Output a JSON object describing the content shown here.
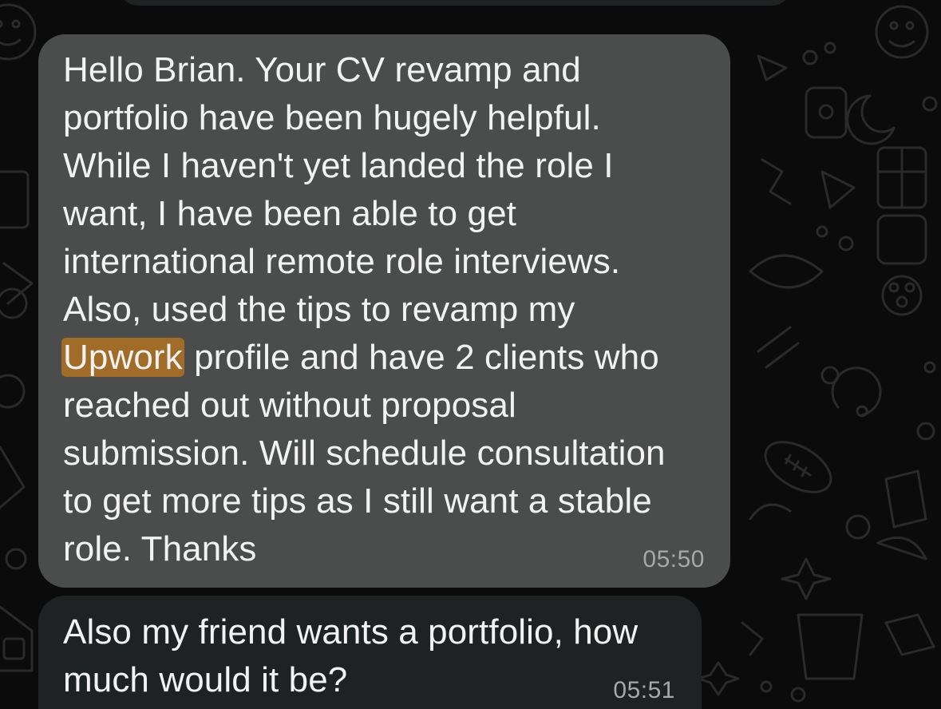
{
  "conversation": {
    "wallpaper": "doodle-pattern-dark",
    "colors": {
      "incoming_bubble": "#4b4c4c",
      "incoming_bubble_dark": "#1f2223",
      "search_highlight": "#a06c28",
      "text": "#f2f2f2",
      "timestamp": "#a7a8a8"
    },
    "messages": [
      {
        "lines": [
          "Hello Brian. Your CV revamp and",
          "portfolio have been hugely helpful.",
          "While I haven't yet landed the role I",
          "want, I have been able to get",
          "international remote role interviews.",
          "Also, used the tips to revamp my"
        ],
        "highlight_word": "Upwork",
        "highlight_line_rest": " profile and have 2 clients who",
        "lines_after": [
          "reached out without proposal",
          "submission. Will schedule consultation",
          "to get more tips as I still want a stable",
          "role. Thanks"
        ],
        "time": "05:50"
      },
      {
        "lines": [
          "Also my friend wants a portfolio, how",
          "much would it be?"
        ],
        "time": "05:51"
      }
    ]
  }
}
